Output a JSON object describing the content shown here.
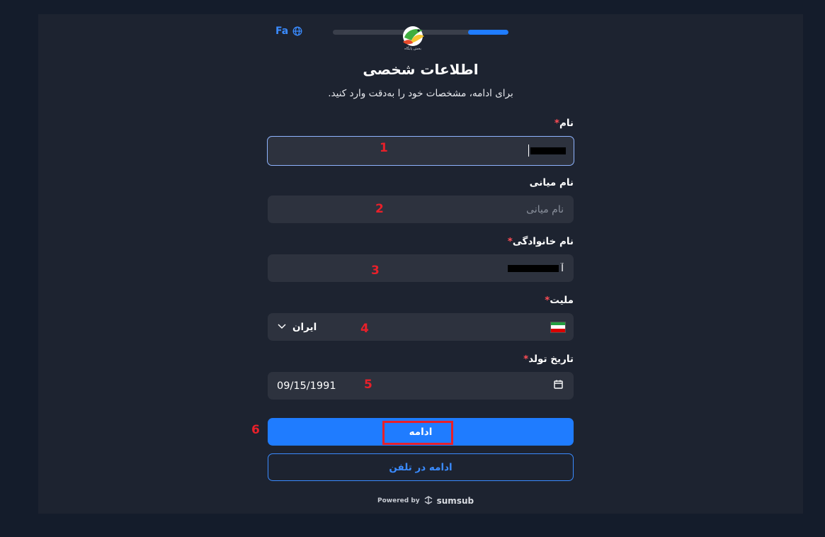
{
  "header": {
    "language": "Fa",
    "progress_fraction": 0.23,
    "logo_caption": "بخش پایگاه"
  },
  "page": {
    "title": "اطلاعات شخصی",
    "subtitle": "برای ادامه، مشخصات خود را به‌دقت وارد کنید."
  },
  "form": {
    "first_name": {
      "label": "نام",
      "required_mark": "*",
      "value": ""
    },
    "middle_name": {
      "label": "نام میانی",
      "placeholder": "نام میانی",
      "value": ""
    },
    "last_name": {
      "label": "نام خانوادگی",
      "required_mark": "*",
      "value": "آ"
    },
    "nationality": {
      "label": "ملیت",
      "required_mark": "*",
      "value": "ایران",
      "flag": [
        "#239f40",
        "#ffffff",
        "#da0000"
      ]
    },
    "birth_date": {
      "label": "تاریخ تولد",
      "required_mark": "*",
      "value": "09/15/1991"
    }
  },
  "actions": {
    "continue_label": "ادامه",
    "continue_on_phone_label": "ادامه در تلفن"
  },
  "annotations": [
    "1",
    "2",
    "3",
    "4",
    "5",
    "6"
  ],
  "footer": {
    "powered_by": "Powered by",
    "brand": "sumsub"
  },
  "colors": {
    "accent": "#1f7cff",
    "annotation": "#e8202a",
    "required": "#ff4d55"
  }
}
